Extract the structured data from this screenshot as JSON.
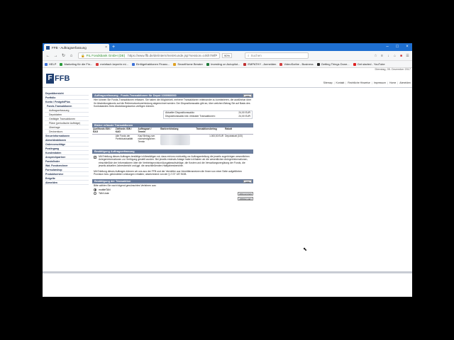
{
  "browser": {
    "tab_title": "FFB - Auftragserfassung",
    "url_site": "FIL Fondsbank GmbH (DE)",
    "url": "https://www.ffb.de/de/intern/meinKunde.jsp?session=c4kh7WfPpZgT...",
    "zoom": "90%",
    "search_placeholder": "Suchen",
    "bookmarks": [
      "HELP",
      "Marketing für die Fin...",
      "meinfach keprehr mi...",
      "Einfügefraktionen Financ...",
      "SmartHome Berater",
      "Investing on Autopilot...",
      "EMPATHY - Anmelden",
      "VideoScribe - Business",
      "Getting Things Done...",
      "Get started - YouTube"
    ]
  },
  "header": {
    "date": "Dienstag, 05. Dezember 2017",
    "logo_text": "FFB",
    "links": [
      "Sitemap",
      "Kontakt",
      "Rechtliche Hinweise",
      "Impressum",
      "Home",
      "Abmelden"
    ]
  },
  "sidebar": [
    {
      "label": "Depotübersicht",
      "level": 0
    },
    {
      "label": "Portfolio",
      "level": 0
    },
    {
      "label": "Konto / FestgeldPlus",
      "level": 0
    },
    {
      "label": "Fonds-Transaktionen",
      "level": 1
    },
    {
      "label": "Auftragserfassung",
      "level": 2
    },
    {
      "label": "Depotdaten",
      "level": 2
    },
    {
      "label": "Getätigte Transaktionen",
      "level": 2
    },
    {
      "label": "Pläne (periodische Aufträge)",
      "level": 2
    },
    {
      "label": "Übertrage",
      "level": 2
    },
    {
      "label": "Devisenkurs",
      "level": 2
    },
    {
      "label": "Steuerinformationen",
      "level": 0
    },
    {
      "label": "Abmeldeaktionen",
      "level": 0
    },
    {
      "label": "Ordervorschläge",
      "level": 0
    },
    {
      "label": "Postingang",
      "level": 0
    },
    {
      "label": "Kundendaten",
      "level": 0
    },
    {
      "label": "Ansprechpartner",
      "level": 0
    },
    {
      "label": "Fondsfinder",
      "level": 0
    },
    {
      "label": "Wat. Fondsrechner",
      "level": 0
    },
    {
      "label": "Formularshop",
      "level": 0
    },
    {
      "label": "Produktservice",
      "level": 0
    },
    {
      "label": "Entgelte",
      "level": 0
    },
    {
      "label": "Abmelden",
      "level": 0
    }
  ],
  "section1": {
    "title": "Auftragserfassung - Fonds-Transaktionen für Depot 1000960000",
    "button": "Hilfe",
    "text": "Hier können Sie Fonds-Transaktionen erfassen. Sie haben die Möglichkeit, mehrere Transaktionen miteinander zu kombinieren, die ausführbar über Ihr Abwicklungskonto auf die Referenzkontoverbindung abgerechnet werden. Der Dispositionssaldo gibt an, über welchen Betrag Sie auf Basis des Kontostandes Ihres Abwicklungskontos verfügen können.",
    "balance_rows": [
      {
        "label": "Aktueller Dispositionssaldo:",
        "value": "24,00 EUR"
      },
      {
        "label": "Dispositionssaldo inkl. erfasster Transaktionen:",
        "value": "24,00 EUR"
      }
    ]
  },
  "section2": {
    "title": "Bisher erfasste Transaktionen",
    "columns": [
      "Quellfonds ISIN / KAG",
      "Zielfonds ISIN / KAG",
      "Auftragsart / Termin",
      "Bankverbindung",
      "Transaktionsbetrag",
      "Rabatt"
    ],
    "row": {
      "quell": "",
      "ziel": "Alle Fonds der Portfolioaktualität",
      "art": "Kauf Betrag zum nächstmöglichen Termin",
      "bank": "",
      "betrag": "1.000,50 EUR",
      "rabatt": "Depotrabatt (100)"
    }
  },
  "section3": {
    "title": "Bestätigung Auftragserfassung",
    "check_text": "Mit Erteilung dieses Auftrages bestätige ich/bestätigen wir, dass mir/uns rechtzeitig vor Auftragserteilung die jeweils zugehörigen wesentlichen Anlegerinformationen zur Verfügung gestellt wurden. Bei jeweils erstmals Anlage habe ich/haben wir die wesentlichen Anlegerinformationen, einschließlich der Informationen über die Vertriebsprovision/Ausgabeaufschläge, die Kosten und die Verwaltungsvergütung der Fonds, die jeweils aktuellen Jahresbericht und ggf. die anschließenden Halbjahresberichte.",
    "note": "Mit Erteilung dieses Auftrages können wir uns aus der FFB und der Vermittler aus Vermittleranreizen die Ihnen von einer Seite aufgeführten Provision bzw. gekündeten Leistungen erhalten; abzeichnend von der § 2 GT 187 BGB."
  },
  "section4": {
    "title": "Bestätigung der Transaktion",
    "button": "Hilfe",
    "question": "Bitte wählen Sie nach folgend gewünschtes Verfahren aus:",
    "options": [
      {
        "label": "mobileTAN",
        "selected": true
      },
      {
        "label": "TAN Liste",
        "selected": false
      }
    ],
    "btn_next": "ABSCHICKEN",
    "btn_cancel": "ABBRECHEN"
  }
}
